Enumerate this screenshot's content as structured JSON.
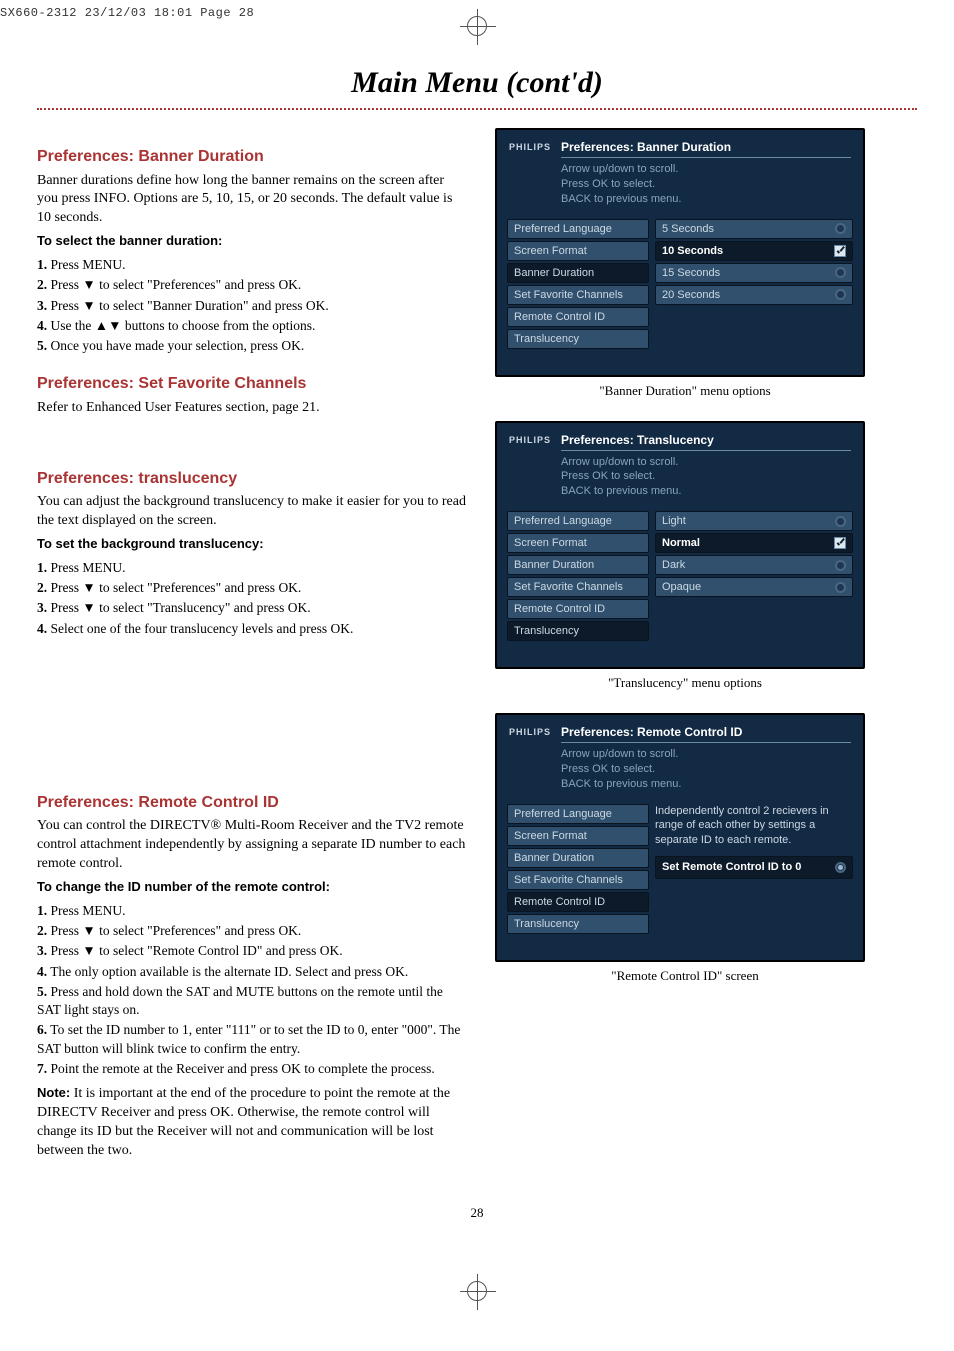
{
  "header_line": "SX660-2312  23/12/03  18:01  Page 28",
  "main_title": "Main Menu (cont'd)",
  "page_number": "28",
  "left": {
    "s1": {
      "heading": "Preferences: Banner Duration",
      "intro": "Banner durations define how long the banner remains on the screen after you press INFO. Options are 5, 10, 15, or 20 seconds. The default value is 10 seconds.",
      "sub": "To select the banner duration:",
      "steps": [
        "Press MENU.",
        "Press ▼ to select \"Preferences\" and press OK.",
        "Press ▼ to select \"Banner Duration\" and press OK.",
        "Use the ▲▼ buttons to choose from the options.",
        "Once you have made your selection, press OK."
      ]
    },
    "s2": {
      "heading": "Preferences: Set Favorite Channels",
      "intro": "Refer to Enhanced User Features section, page 21."
    },
    "s3": {
      "heading": "Preferences: translucency",
      "intro": "You can adjust the background translucency to make it easier for you to read the text displayed on the screen.",
      "sub": "To set the background translucency:",
      "steps": [
        "Press MENU.",
        "Press ▼ to select \"Preferences\" and press OK.",
        "Press ▼ to select \"Translucency\" and press OK.",
        "Select one of the four translucency levels and press OK."
      ]
    },
    "s4": {
      "heading": "Preferences: Remote Control ID",
      "intro": "You can control the DIRECTV® Multi-Room Receiver and the TV2 remote control attachment independently by assigning a separate ID number to each remote control.",
      "sub": "To change the ID number of the remote control:",
      "steps": [
        "Press MENU.",
        "Press ▼ to select \"Preferences\" and press OK.",
        "Press ▼ to select \"Remote Control ID\" and press OK.",
        "The only option available is the alternate ID. Select and press OK.",
        "Press and hold down the SAT and MUTE buttons on the remote until the SAT light stays on.",
        "To set the ID number to 1, enter \"111\" or to set the ID to 0, enter \"000\". The SAT button will blink twice to confirm the entry.",
        "Point the remote at the Receiver and press OK to complete the process."
      ],
      "note_label": "Note:",
      "note": "It is important at the end of the procedure to point the remote at the DIRECTV Receiver and press OK. Otherwise, the remote control will change its ID but the Receiver will not and communication will be lost between the two."
    }
  },
  "tv_common": {
    "brand": "PHILIPS",
    "hint1": "Arrow up/down to scroll.",
    "hint2": "Press OK to select.",
    "hint3": "BACK to previous menu.",
    "menu": [
      "Preferred Language",
      "Screen Format",
      "Banner Duration",
      "Set Favorite Channels",
      "Remote Control ID",
      "Translucency"
    ]
  },
  "tv1": {
    "title": "Preferences: Banner Duration",
    "opts": [
      "5  Seconds",
      "10 Seconds",
      "15 Seconds",
      "20 Seconds"
    ],
    "selected": 1,
    "caption": "\"Banner Duration\" menu options"
  },
  "tv2": {
    "title": "Preferences: Translucency",
    "opts": [
      "Light",
      "Normal",
      "Dark",
      "Opaque"
    ],
    "selected": 1,
    "caption": "\"Translucency\" menu options"
  },
  "tv3": {
    "title": "Preferences: Remote Control ID",
    "info": "Independently control 2 recievers in range of each other by settings a separate ID to each remote.",
    "button": "Set Remote Control ID to 0",
    "caption": "\"Remote Control ID\" screen"
  }
}
